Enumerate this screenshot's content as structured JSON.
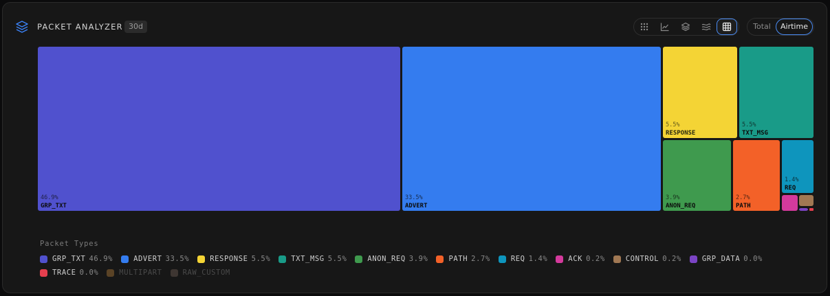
{
  "header": {
    "title": "PACKET ANALYZER",
    "period": "30d"
  },
  "metric_toggle": {
    "options": [
      "Total",
      "Airtime"
    ],
    "selected": "Airtime"
  },
  "view_buttons": [
    "grid-dots-icon",
    "line-chart-icon",
    "layers-icon",
    "stream-icon",
    "treemap-grid-icon"
  ],
  "legend": {
    "title": "Packet Types",
    "items": [
      {
        "label": "GRP_TXT",
        "pct": "46.9%",
        "color": "#5051ce"
      },
      {
        "label": "ADVERT",
        "pct": "33.5%",
        "color": "#347cef"
      },
      {
        "label": "RESPONSE",
        "pct": "5.5%",
        "color": "#f4d435"
      },
      {
        "label": "TXT_MSG",
        "pct": "5.5%",
        "color": "#199b88"
      },
      {
        "label": "ANON_REQ",
        "pct": "3.9%",
        "color": "#3f9a4e"
      },
      {
        "label": "PATH",
        "pct": "2.7%",
        "color": "#f36128"
      },
      {
        "label": "REQ",
        "pct": "1.4%",
        "color": "#0e95bd"
      },
      {
        "label": "ACK",
        "pct": "0.2%",
        "color": "#d43a9c"
      },
      {
        "label": "CONTROL",
        "pct": "0.2%",
        "color": "#a07853"
      },
      {
        "label": "GRP_DATA",
        "pct": "0.0%",
        "color": "#7b44c4"
      },
      {
        "label": "TRACE",
        "pct": "0.0%",
        "color": "#e53f4e"
      },
      {
        "label": "MULTIPART",
        "pct": "",
        "color": "#5a4326",
        "dim": true
      },
      {
        "label": "RAW_CUSTOM",
        "pct": "",
        "color": "#3e3632",
        "dim": true
      }
    ]
  },
  "chart_data": {
    "type": "treemap",
    "metric": "Airtime",
    "values": [
      {
        "label": "GRP_TXT",
        "value": 46.9,
        "pct": "46.9%",
        "color": "#5051ce"
      },
      {
        "label": "ADVERT",
        "value": 33.5,
        "pct": "33.5%",
        "color": "#347cef"
      },
      {
        "label": "RESPONSE",
        "value": 5.5,
        "pct": "5.5%",
        "color": "#f4d435"
      },
      {
        "label": "TXT_MSG",
        "value": 5.5,
        "pct": "5.5%",
        "color": "#199b88"
      },
      {
        "label": "ANON_REQ",
        "value": 3.9,
        "pct": "3.9%",
        "color": "#3f9a4e"
      },
      {
        "label": "PATH",
        "value": 2.7,
        "pct": "2.7%",
        "color": "#f36128"
      },
      {
        "label": "REQ",
        "value": 1.4,
        "pct": "1.4%",
        "color": "#0e95bd"
      },
      {
        "label": "ACK",
        "value": 0.2,
        "pct": "",
        "color": "#d43a9c"
      },
      {
        "label": "CONTROL",
        "value": 0.2,
        "pct": "",
        "color": "#a07853"
      },
      {
        "label": "GRP_DATA",
        "value": 0.0,
        "pct": "",
        "color": "#7b44c4"
      },
      {
        "label": "TRACE",
        "value": 0.0,
        "pct": "",
        "color": "#e53f4e"
      }
    ]
  }
}
